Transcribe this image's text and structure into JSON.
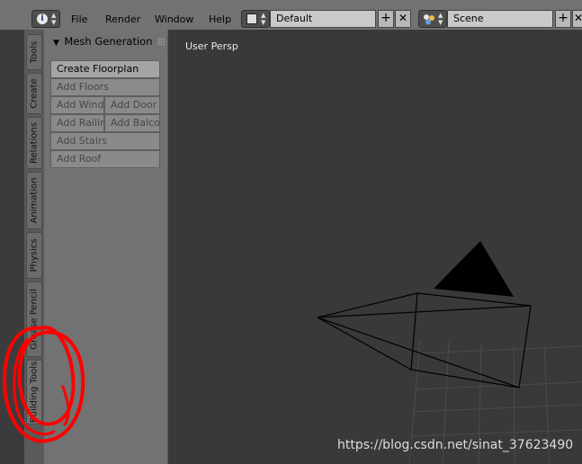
{
  "menu": {
    "file": "File",
    "render": "Render",
    "window": "Window",
    "help": "Help"
  },
  "screen_layout": {
    "value": "Default"
  },
  "scene": {
    "value": "Scene"
  },
  "tabs": [
    {
      "label": "Tools"
    },
    {
      "label": "Create"
    },
    {
      "label": "Relations"
    },
    {
      "label": "Animation"
    },
    {
      "label": "Physics"
    },
    {
      "label": "Grease Pencil"
    },
    {
      "label": "Building Tools"
    }
  ],
  "panel": {
    "title": "Mesh Generation",
    "create_floorplan": "Create Floorplan",
    "add_floors": "Add Floors",
    "add_window": "Add Wind",
    "add_door": "Add Door",
    "add_railing": "Add Railin",
    "add_balcony": "Add Balco",
    "add_stairs": "Add Stairs",
    "add_roof": "Add Roof"
  },
  "viewport": {
    "label": "User Persp"
  },
  "watermark": "https://blog.csdn.net/sinat_37623490",
  "colors": {
    "header": "#727272",
    "panel": "#727272",
    "viewport": "#393939",
    "annotation": "#ff0000"
  }
}
